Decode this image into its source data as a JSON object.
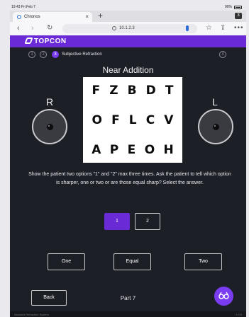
{
  "status_bar": {
    "time": "19:43 Fri Feb 7",
    "battery": "90%"
  },
  "browser": {
    "tab_title": "Chronos",
    "tab_count": "3",
    "url": "10.1.2.3"
  },
  "app": {
    "brand": "TOPCON",
    "steps": [
      "1",
      "2",
      "3",
      "4"
    ],
    "active_step_label": "Subjective Refraction",
    "heading": "Near Addition",
    "chart_rows": [
      [
        "F",
        "Z",
        "B",
        "D",
        "T"
      ],
      [
        "O",
        "F",
        "L",
        "C",
        "V"
      ],
      [
        "A",
        "P",
        "E",
        "O",
        "H"
      ]
    ],
    "right_eye_label": "R",
    "left_eye_label": "L",
    "instructions": "Show the patient two options \"1\" and \"2\" max three times. Ask the patient to tell which option is sharper, one or two or are those equal sharp? Select the answer.",
    "option_1": "1",
    "option_2": "2",
    "answer_one": "One",
    "answer_equal": "Equal",
    "answer_two": "Two",
    "back_label": "Back",
    "part_label": "Part 7",
    "footer_left": "Assisted Refraction System",
    "footer_right": "1.0.0"
  }
}
